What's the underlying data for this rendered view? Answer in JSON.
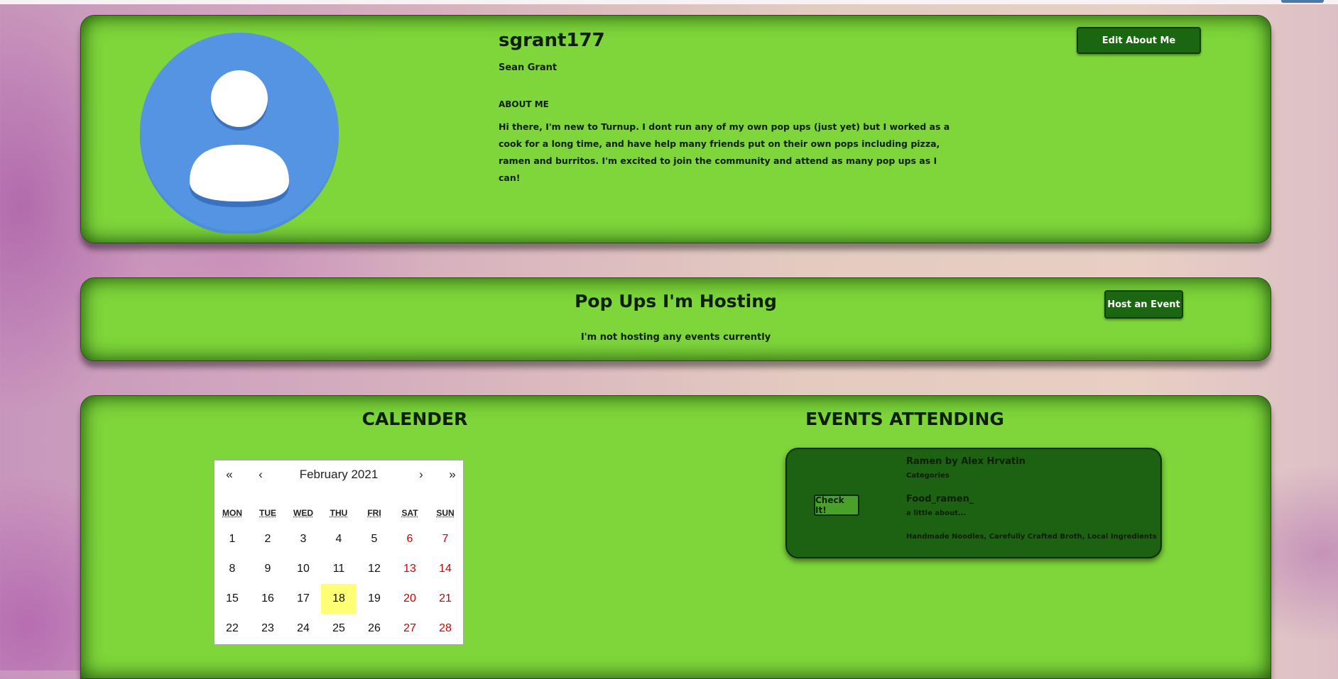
{
  "profile": {
    "username": "sgrant177",
    "full_name": "Sean Grant",
    "about_heading": "ABOUT ME",
    "about_text": "Hi there, I'm new to Turnup. I dont run any of my own pop ups (just yet) but I worked as a cook for a long time, and have help many friends put on their own pops including pizza, ramen and burritos. I'm excited to join the community and attend as many pop ups as I can!",
    "edit_button": "Edit About Me",
    "avatar_icon": "user-avatar-icon"
  },
  "hosting": {
    "title": "Pop Ups I'm Hosting",
    "empty_message": "I'm not hosting any events currently",
    "host_button": "Host an Event"
  },
  "calendar": {
    "title": "CALENDER",
    "nav": {
      "prev_year": "«",
      "prev_month": "‹",
      "next_month": "›",
      "next_year": "»"
    },
    "month_label": "February 2021",
    "weekdays": [
      "MON",
      "TUE",
      "WED",
      "THU",
      "FRI",
      "SAT",
      "SUN"
    ],
    "weeks": [
      [
        "1",
        "2",
        "3",
        "4",
        "5",
        "6",
        "7"
      ],
      [
        "8",
        "9",
        "10",
        "11",
        "12",
        "13",
        "14"
      ],
      [
        "15",
        "16",
        "17",
        "18",
        "19",
        "20",
        "21"
      ],
      [
        "22",
        "23",
        "24",
        "25",
        "26",
        "27",
        "28"
      ]
    ],
    "today": "18"
  },
  "events_attending": {
    "title": "EVENTS ATTENDING",
    "items": [
      {
        "name": "Ramen by Alex Hrvatin",
        "categories": "Categories",
        "handle": "Food_ramen_",
        "about": "a little about...",
        "tags": "Handmade Noodles, Carefully Crafted Broth, Local Ingredients",
        "button": "Check It!"
      }
    ]
  },
  "colors": {
    "panel": "#7ed63a",
    "button": "#1b6610",
    "card": "#1d6212",
    "weekend": "#d10000",
    "today_highlight": "#ffff76"
  }
}
